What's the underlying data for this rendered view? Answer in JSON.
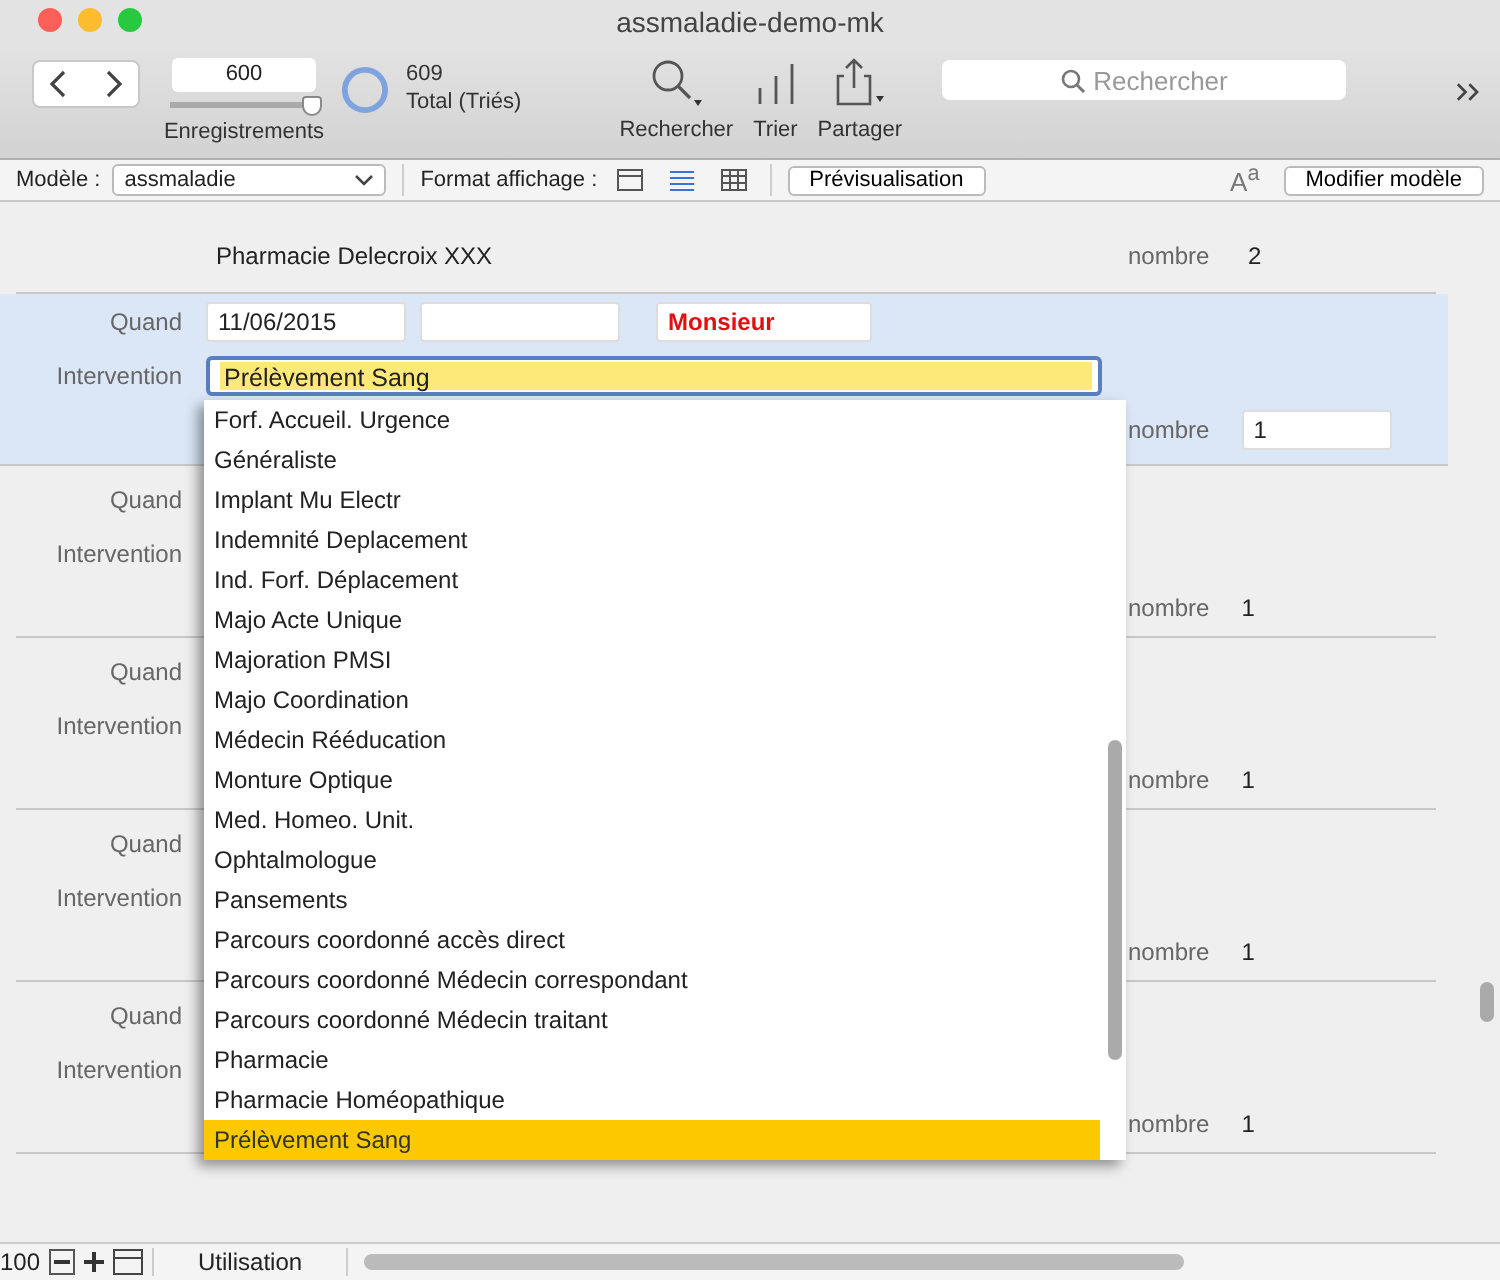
{
  "window": {
    "title": "assmaladie-demo-mk"
  },
  "toolbar": {
    "record_field": "600",
    "slider": {
      "level": 0.95
    },
    "found_count": "609",
    "total_label": "Total (Triés)",
    "records_label": "Enregistrements",
    "tools": [
      {
        "kind": "search",
        "label": "Rechercher"
      },
      {
        "kind": "sort",
        "label": "Trier"
      },
      {
        "kind": "share",
        "label": "Partager"
      }
    ],
    "search": {
      "placeholder": "Rechercher"
    }
  },
  "layout_bar": {
    "layout_label": "Modèle :",
    "layout_select": "assmaladie",
    "format_label": "Format affichage :",
    "views": [
      {
        "kind": "form",
        "selected": false
      },
      {
        "kind": "list",
        "selected": true
      },
      {
        "kind": "table",
        "selected": false
      }
    ],
    "preview_button": "Prévisualisation",
    "text_size": "A$^{a}$",
    "edit_button": "Modifier modèle"
  },
  "records": [
    {
      "kind": "partial",
      "selected": false,
      "name": "Pharmacie Delecroix XXX",
      "nombre_label": "nombre",
      "nombre": "2"
    },
    {
      "kind": "full",
      "selected": true,
      "quand_label": "Quand",
      "date": "11/06/2015",
      "title": "Monsieur",
      "intervention_label": "Intervention",
      "intervention": "Prélèvement Sang",
      "nombre_label": "nombre",
      "nombre": "1"
    },
    {
      "kind": "full",
      "selected": false,
      "quand_label": "Quand",
      "intervention_label": "Intervention",
      "nombre_label": "nombre",
      "nombre": "1"
    },
    {
      "kind": "full",
      "selected": false,
      "quand_label": "Quand",
      "intervention_label": "Intervention",
      "nombre_label": "nombre",
      "nombre": "1"
    },
    {
      "kind": "full",
      "selected": false,
      "quand_label": "Quand",
      "intervention_label": "Intervention",
      "nombre_label": "nombre",
      "nombre": "1"
    },
    {
      "kind": "full",
      "selected": false,
      "quand_label": "Quand",
      "intervention_label": "Intervention",
      "nombre_label": "nombre",
      "nombre": "1"
    }
  ],
  "dropdown": {
    "items": [
      {
        "label": "Forf. Accueil. Urgence",
        "selected": false
      },
      {
        "label": "Généraliste",
        "selected": false
      },
      {
        "label": "Implant Mu Electr",
        "selected": false
      },
      {
        "label": "Indemnité Deplacement",
        "selected": false
      },
      {
        "label": "Ind. Forf. Déplacement",
        "selected": false
      },
      {
        "label": "Majo Acte Unique",
        "selected": false
      },
      {
        "label": "Majoration PMSI",
        "selected": false
      },
      {
        "label": "Majo Coordination",
        "selected": false
      },
      {
        "label": "Médecin Rééducation",
        "selected": false
      },
      {
        "label": "Monture Optique",
        "selected": false
      },
      {
        "label": "Med. Homeo. Unit.",
        "selected": false
      },
      {
        "label": "Ophtalmologue",
        "selected": false
      },
      {
        "label": "Pansements",
        "selected": false
      },
      {
        "label": "Parcours coordonné accès direct",
        "selected": false
      },
      {
        "label": "Parcours coordonné Médecin correspondant",
        "selected": false
      },
      {
        "label": "Parcours coordonné Médecin traitant",
        "selected": false
      },
      {
        "label": "Pharmacie",
        "selected": false
      },
      {
        "label": "Pharmacie Homéopathique",
        "selected": false
      },
      {
        "label": "Prélèvement Sang",
        "selected": true
      }
    ]
  },
  "status_bar": {
    "zoom": "100",
    "mode": "Utilisation"
  }
}
